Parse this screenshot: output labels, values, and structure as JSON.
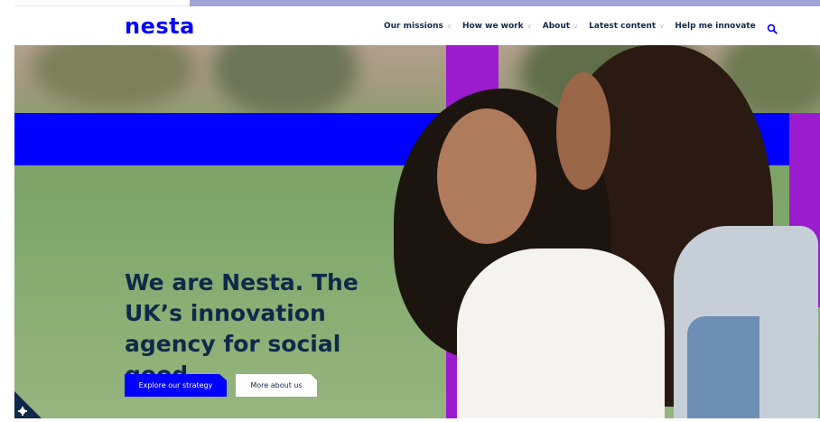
{
  "brand": {
    "logo_text": "nesta",
    "primary_color": "#0000ff",
    "purple_color": "#9b1ccf",
    "navy_color": "#0f294a"
  },
  "nav": {
    "items": [
      {
        "label": "Our missions",
        "has_dropdown": true
      },
      {
        "label": "How we work",
        "has_dropdown": true
      },
      {
        "label": "About",
        "has_dropdown": true
      },
      {
        "label": "Latest content",
        "has_dropdown": true
      },
      {
        "label": "Help me innovate",
        "has_dropdown": false
      }
    ],
    "search_icon": "search-icon"
  },
  "hero": {
    "headline": "We are Nesta. The UK’s innovation agency for social good.",
    "primary_button": "Explore our strategy",
    "secondary_button": "More about us"
  },
  "cookie": {
    "icon": "gear-icon"
  }
}
